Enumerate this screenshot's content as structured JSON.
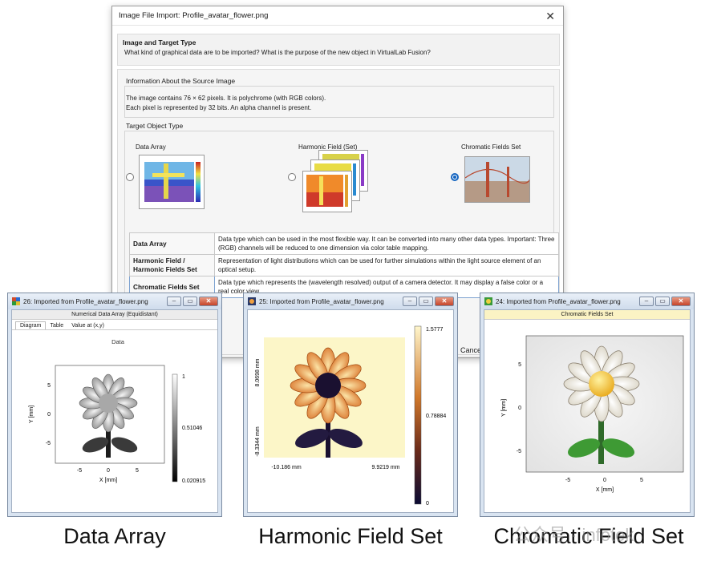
{
  "dialog": {
    "title": "Image File Import: Profile_avatar_flower.png",
    "close_glyph": "✕",
    "heading": "Image and Target Type",
    "subheading": "What kind of graphical data are to be imported? What is the purpose of the new object in VirtualLab Fusion?",
    "info_group": {
      "label": "Information About the Source Image",
      "line1": "The image contains 76 × 62 pixels. It is polychrome (with RGB colors).",
      "line2": "Each pixel is represented by 32 bits. An alpha channel is present."
    },
    "target_group": {
      "label": "Target Object Type",
      "options": [
        {
          "label": "Data Array",
          "selected": false
        },
        {
          "label": "Harmonic Field (Set)",
          "selected": false
        },
        {
          "label": "Chromatic Fields Set",
          "selected": true
        }
      ]
    },
    "table": [
      {
        "key": "Data Array",
        "value": "Data type which can be used in the most flexible way. It can be converted into many other data types. Important: Three (RGB) channels will be reduced to one dimension via color table mapping."
      },
      {
        "key": "Harmonic Field / Harmonic Fields Set",
        "value": "Representation of light distributions which can be used for further simulations within the light source element of an optical setup."
      },
      {
        "key": "Chromatic Fields Set",
        "value": "Data type which represents the (wavelength resolved) output of a camera detector. It may display a false color or a real color view."
      }
    ],
    "cancel_label": "Cance"
  },
  "windows": {
    "data_array": {
      "title": "26: Imported from Profile_avatar_flower.png",
      "subtitle": "Numerical Data Array (Equidistant)",
      "tabs": [
        "Diagram",
        "Table",
        "Value at (x,y)"
      ],
      "plot_title": "Data",
      "xlabel": "X [mm]",
      "ylabel": "Y [mm]",
      "xticks": [
        "-5",
        "0",
        "5"
      ],
      "yticks": [
        "5",
        "0",
        "-5"
      ],
      "colorbar_ticks": [
        "1",
        "0.51046",
        "0.020915"
      ]
    },
    "harmonic": {
      "title": "25: Imported from Profile_avatar_flower.png",
      "xticks": [
        "-10.186 mm",
        "9.9219 mm"
      ],
      "yticks": [
        "8.0698 mm",
        "-8.3344 mm"
      ],
      "colorbar_ticks": [
        "1.5777",
        "0.78884",
        "0"
      ]
    },
    "chromatic": {
      "title": "24: Imported from Profile_avatar_flower.png",
      "subtitle": "Chromatic Fields Set",
      "xlabel": "X [mm]",
      "ylabel": "Y [mm]",
      "xticks": [
        "-5",
        "0",
        "5"
      ],
      "yticks": [
        "5",
        "0",
        "-5"
      ]
    }
  },
  "window_buttons": {
    "minimize": "–",
    "restore": "▭",
    "close": "✕"
  },
  "captions": [
    "Data Array",
    "Harmonic Field Set",
    "Chromatic Field Set"
  ],
  "watermark": "公众号 · infotek"
}
